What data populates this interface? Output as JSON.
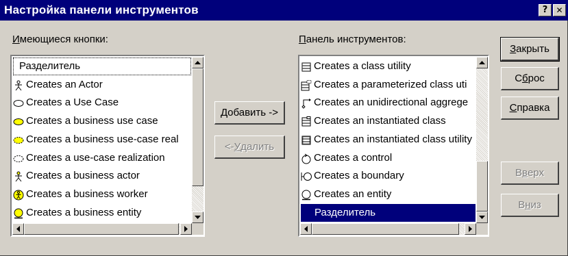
{
  "window": {
    "title": "Настройка панели инструментов",
    "help_btn": "?",
    "close_btn": "✕"
  },
  "available": {
    "label_ul": "И",
    "label_rest": "меющиеся кнопки:",
    "items": [
      {
        "text": "Разделитель",
        "icon": "none"
      },
      {
        "text": "Creates an Actor",
        "icon": "actor-icon"
      },
      {
        "text": "Creates a Use Case",
        "icon": "use-case-icon"
      },
      {
        "text": "Creates a business use case",
        "icon": "business-use-case-icon"
      },
      {
        "text": "Creates a business use-case real",
        "icon": "business-use-case-realization-icon"
      },
      {
        "text": "Creates a use-case realization",
        "icon": "use-case-realization-icon"
      },
      {
        "text": "Creates a business actor",
        "icon": "business-actor-icon"
      },
      {
        "text": "Creates a business worker",
        "icon": "business-worker-icon"
      },
      {
        "text": "Creates a business entity",
        "icon": "business-entity-icon"
      }
    ]
  },
  "toolbar": {
    "label_ul": "П",
    "label_rest": "анель инструментов:",
    "items": [
      {
        "text": "Creates a class utility",
        "icon": "class-utility-icon"
      },
      {
        "text": "Creates a parameterized class uti",
        "icon": "parameterized-class-utility-icon"
      },
      {
        "text": "Creates an unidirectional aggrege",
        "icon": "unidirectional-aggregation-icon"
      },
      {
        "text": "Creates an instantiated class",
        "icon": "instantiated-class-icon"
      },
      {
        "text": "Creates an instantiated class utility",
        "icon": "instantiated-class-utility-icon"
      },
      {
        "text": "Creates a control",
        "icon": "control-icon"
      },
      {
        "text": "Creates a boundary",
        "icon": "boundary-icon"
      },
      {
        "text": "Creates an entity",
        "icon": "entity-icon"
      },
      {
        "text": "Разделитель",
        "icon": "none",
        "selected": true
      }
    ]
  },
  "buttons": {
    "add_ul": "Д",
    "add_rest": "обавить ->",
    "remove_pre": "<-",
    "remove_ul": "У",
    "remove_rest": "далить",
    "close_ul": "З",
    "close_rest": "акрыть",
    "reset_pre": "С",
    "reset_ul": "б",
    "reset_rest": "рос",
    "help_ul": "С",
    "help_rest": "правка",
    "up_pre": "В",
    "up_ul": "в",
    "up_rest": "ерх",
    "down_pre": "В",
    "down_ul": "н",
    "down_rest": "из"
  }
}
